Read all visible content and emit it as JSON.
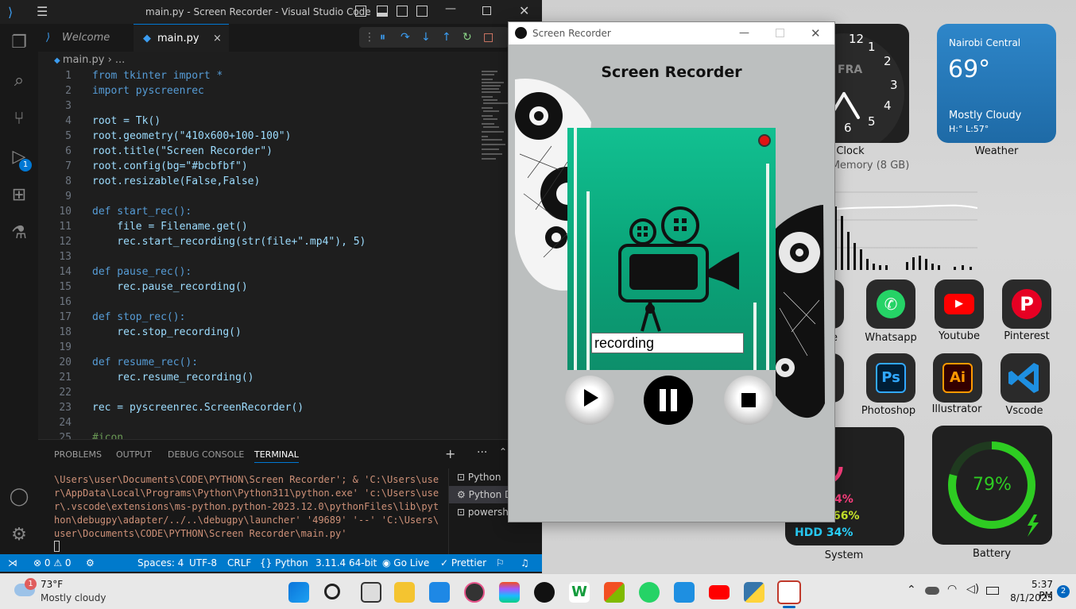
{
  "vscode": {
    "title": "main.py - Screen Recorder - Visual Studio Code",
    "tabs": [
      {
        "label": "Welcome"
      },
      {
        "label": "main.py"
      }
    ],
    "breadcrumb": "main.py › ...",
    "code": [
      {
        "n": "1",
        "t": "from tkinter import *"
      },
      {
        "n": "2",
        "t": "import pyscreenrec"
      },
      {
        "n": "3",
        "t": ""
      },
      {
        "n": "4",
        "t": "root = Tk()"
      },
      {
        "n": "5",
        "t": "root.geometry(\"410x600+100-100\")"
      },
      {
        "n": "6",
        "t": "root.title(\"Screen Recorder\")"
      },
      {
        "n": "7",
        "t": "root.config(bg=\"#bcbfbf\")"
      },
      {
        "n": "8",
        "t": "root.resizable(False,False)"
      },
      {
        "n": "9",
        "t": ""
      },
      {
        "n": "10",
        "t": "def start_rec():"
      },
      {
        "n": "11",
        "t": "    file = Filename.get()"
      },
      {
        "n": "12",
        "t": "    rec.start_recording(str(file+\".mp4\"), 5)"
      },
      {
        "n": "13",
        "t": ""
      },
      {
        "n": "14",
        "t": "def pause_rec():"
      },
      {
        "n": "15",
        "t": "    rec.pause_recording()"
      },
      {
        "n": "16",
        "t": ""
      },
      {
        "n": "17",
        "t": "def stop_rec():"
      },
      {
        "n": "18",
        "t": "    rec.stop_recording()"
      },
      {
        "n": "19",
        "t": ""
      },
      {
        "n": "20",
        "t": "def resume_rec():"
      },
      {
        "n": "21",
        "t": "    rec.resume_recording()"
      },
      {
        "n": "22",
        "t": ""
      },
      {
        "n": "23",
        "t": "rec = pyscreenrec.ScreenRecorder()"
      },
      {
        "n": "24",
        "t": ""
      },
      {
        "n": "25",
        "t": "#icon"
      }
    ],
    "panel_tabs": [
      "PROBLEMS",
      "OUTPUT",
      "DEBUG CONSOLE",
      "TERMINAL"
    ],
    "terminal_lines": [
      "\\Users\\user\\Documents\\CODE\\PYTHON\\Screen Recorder'; & 'C:\\Users\\use",
      "r\\AppData\\Local\\Programs\\Python\\Python311\\python.exe' 'c:\\Users\\use",
      "r\\.vscode\\extensions\\ms-python.python-2023.12.0\\pythonFiles\\lib\\pyt",
      "hon\\debugpy\\adapter/../..\\debugpy\\launcher' '49689' '--' 'C:\\Users\\",
      "user\\Documents\\CODE\\PYTHON\\Screen Recorder\\main.py'"
    ],
    "terminal_list": [
      "Python",
      "Python D",
      "powersh"
    ],
    "status": {
      "errors": "0",
      "warnings": "0",
      "spaces": "Spaces: 4",
      "encoding": "UTF-8",
      "eol": "CRLF",
      "language": "Python",
      "version": "3.11.4 64-bit",
      "golive": "Go Live",
      "prettier": "Prettier"
    },
    "debug_badge": "1"
  },
  "recorder": {
    "title": "Screen Recorder",
    "heading": "Screen Recorder",
    "filename_value": "recording"
  },
  "widgets": {
    "clock_label": "Clock",
    "clock_day": "FRA",
    "clock_numbers": [
      "12",
      "1",
      "2",
      "3",
      "4",
      "5",
      "6"
    ],
    "weather_location": "Nairobi Central",
    "weather_temp": "69°",
    "weather_cond": "Mostly Cloudy",
    "weather_hl": "H:° L:57°",
    "weather_label": "Weather",
    "memory_label": "Memory (8 GB)",
    "apps": [
      {
        "label": "e"
      },
      {
        "label": "Whatsapp"
      },
      {
        "label": "Youtube"
      },
      {
        "label": "Pinterest"
      },
      {
        "label": "Photoshop"
      },
      {
        "label": "Illustrator"
      },
      {
        "label": "Vscode"
      }
    ],
    "system_cpu": "4%",
    "system_ram": "66%",
    "system_hdd": "HDD 34%",
    "system_label": "System",
    "battery_pct": "79%",
    "battery_label": "Battery",
    "battery_level": 0.79
  },
  "taskbar": {
    "weather_temp": "73°F",
    "weather_cond": "Mostly cloudy",
    "weather_badge": "1",
    "time": "5:37 PM",
    "date": "8/1/2023",
    "notif_badge": "2"
  }
}
